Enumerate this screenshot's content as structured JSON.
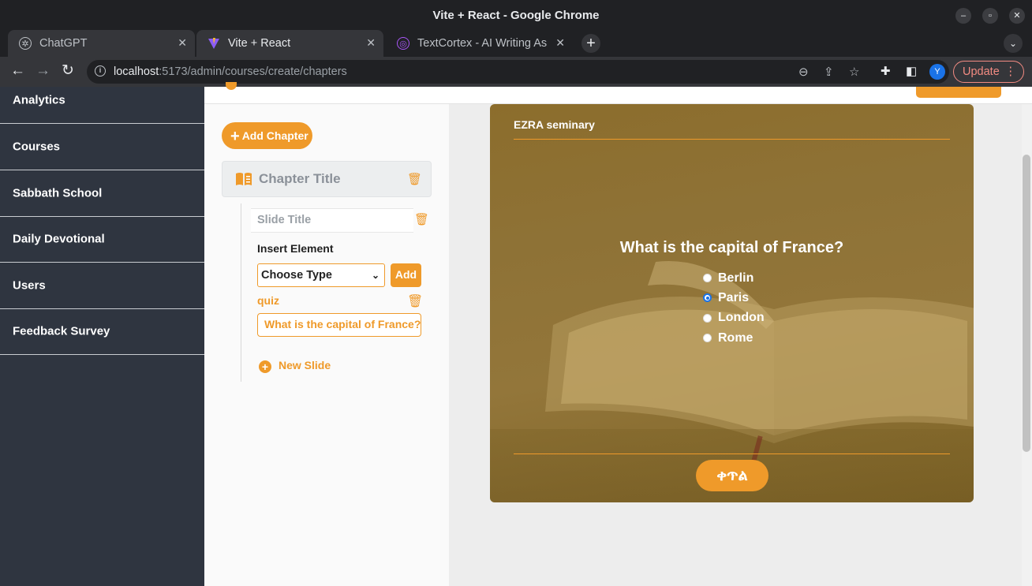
{
  "window": {
    "title": "Vite + React - Google Chrome"
  },
  "tabs": [
    {
      "label": "ChatGPT",
      "icon": "chatgpt-icon"
    },
    {
      "label": "Vite + React",
      "icon": "vite-icon",
      "active": true
    },
    {
      "label": "TextCortex - AI Writing As",
      "icon": "textcortex-icon"
    }
  ],
  "address_bar": {
    "host": "localhost",
    "rest": ":5173/admin/courses/create/chapters"
  },
  "profile": {
    "initial": "Y"
  },
  "update_button": {
    "label": "Update"
  },
  "sidebar": {
    "items": [
      {
        "label": "Analytics"
      },
      {
        "label": "Courses"
      },
      {
        "label": "Sabbath School"
      },
      {
        "label": "Daily Devotional"
      },
      {
        "label": "Users"
      },
      {
        "label": "Feedback Survey"
      }
    ]
  },
  "editor": {
    "add_chapter_label": "Add Chapter",
    "chapter_title_placeholder": "Chapter Title",
    "slide_title_placeholder": "Slide Title",
    "insert_element_label": "Insert Element",
    "choose_type_value": "Choose Type",
    "add_label": "Add",
    "element_type": "quiz",
    "quiz_question_value": "What is the capital of France?",
    "new_slide_label": "New Slide"
  },
  "preview": {
    "brand": "EZRA seminary",
    "question": "What is the capital of France?",
    "options": [
      {
        "label": "Berlin",
        "selected": false
      },
      {
        "label": "Paris",
        "selected": true
      },
      {
        "label": "London",
        "selected": false
      },
      {
        "label": "Rome",
        "selected": false
      }
    ],
    "next_label": "ቀጥል"
  },
  "colors": {
    "accent": "#ef9a2a",
    "sidebar_bg": "#2f3540",
    "card_overlay": "#8e7236"
  }
}
